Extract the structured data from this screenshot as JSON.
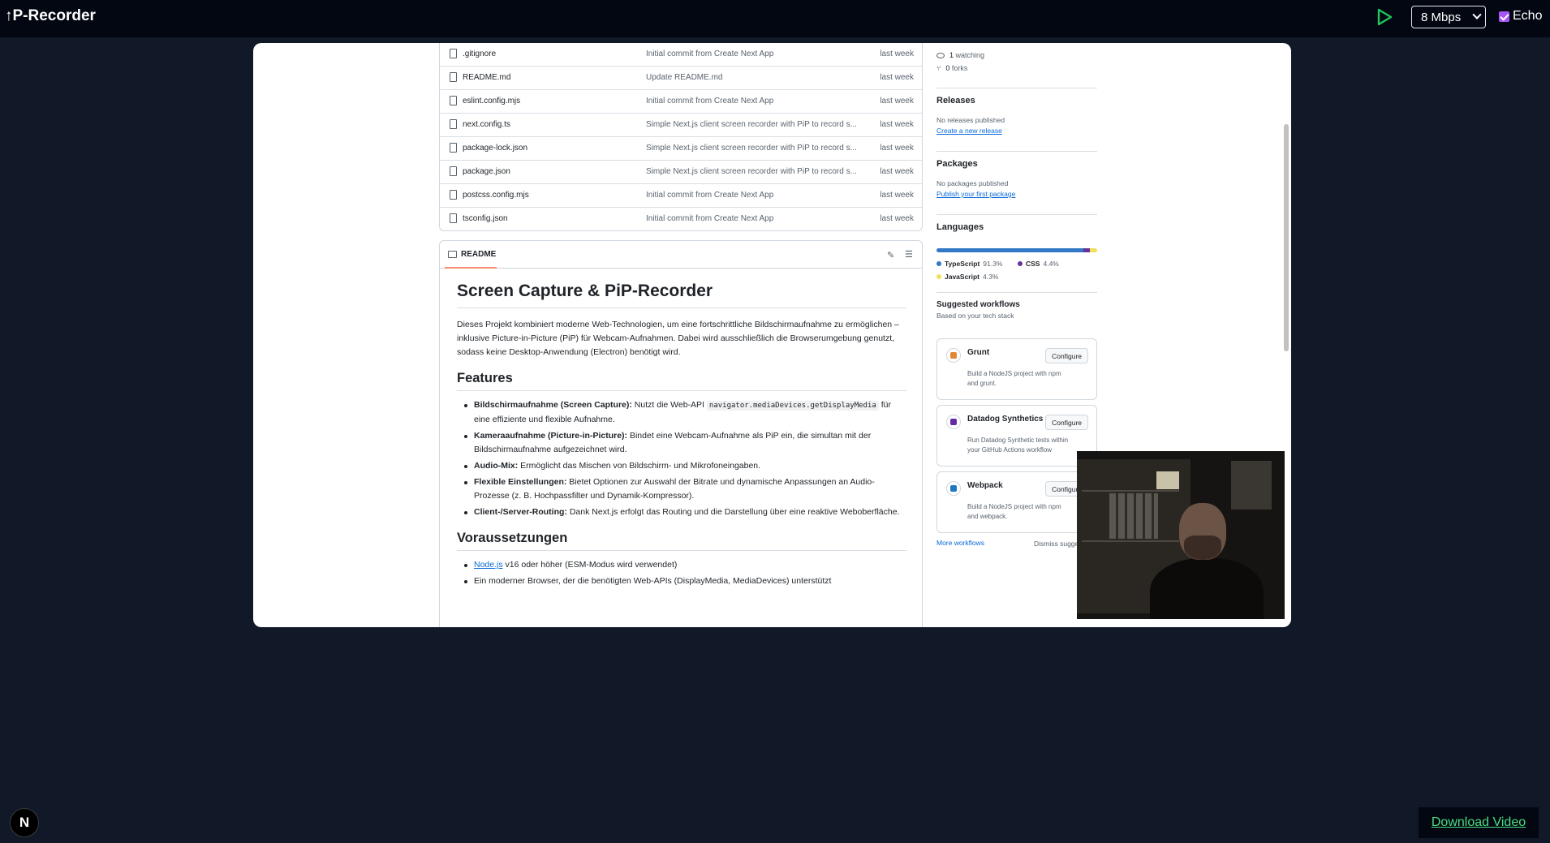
{
  "app": {
    "title": "↑P-Recorder"
  },
  "toolbar": {
    "bitrate_selected": "8 Mbps",
    "echo_label": "Echo",
    "echo_checked": true,
    "accent_color": "#22c55e",
    "checkbox_color": "#a855f7"
  },
  "files": [
    {
      "name": ".gitignore",
      "message": "Initial commit from Create Next App",
      "date": "last week"
    },
    {
      "name": "README.md",
      "message": "Update README.md",
      "date": "last week"
    },
    {
      "name": "eslint.config.mjs",
      "message": "Initial commit from Create Next App",
      "date": "last week"
    },
    {
      "name": "next.config.ts",
      "message": "Simple Next.js client screen recorder with PiP to record s...",
      "date": "last week"
    },
    {
      "name": "package-lock.json",
      "message": "Simple Next.js client screen recorder with PiP to record s...",
      "date": "last week"
    },
    {
      "name": "package.json",
      "message": "Simple Next.js client screen recorder with PiP to record s...",
      "date": "last week"
    },
    {
      "name": "postcss.config.mjs",
      "message": "Initial commit from Create Next App",
      "date": "last week"
    },
    {
      "name": "tsconfig.json",
      "message": "Initial commit from Create Next App",
      "date": "last week"
    }
  ],
  "readme": {
    "tab_label": "README",
    "title": "Screen Capture & PiP-Recorder",
    "intro": "Dieses Projekt kombiniert moderne Web-Technologien, um eine fortschrittliche Bildschirmaufnahme zu ermöglichen – inklusive Picture-in-Picture (PiP) für Webcam-Aufnahmen. Dabei wird ausschließlich die Browserumgebung genutzt, sodass keine Desktop-Anwendung (Electron) benötigt wird.",
    "features_heading": "Features",
    "features": {
      "f1_bold": "Bildschirmaufnahme (Screen Capture):",
      "f1_pre": " Nutzt die Web-API ",
      "f1_code": "navigator.mediaDevices.getDisplayMedia",
      "f1_post": " für eine effiziente und flexible Aufnahme.",
      "f2_bold": "Kameraaufnahme (Picture-in-Picture):",
      "f2_text": " Bindet eine Webcam-Aufnahme als PiP ein, die simultan mit der Bildschirmaufnahme aufgezeichnet wird.",
      "f3_bold": "Audio-Mix:",
      "f3_text": " Ermöglicht das Mischen von Bildschirm- und Mikrofoneingaben.",
      "f4_bold": "Flexible Einstellungen:",
      "f4_text": " Bietet Optionen zur Auswahl der Bitrate und dynamische Anpassungen an Audio-Prozesse (z. B. Hochpassfilter und Dynamik-Kompressor).",
      "f5_bold": "Client-/Server-Routing:",
      "f5_text": " Dank Next.js erfolgt das Routing und die Darstellung über eine reaktive Weboberfläche."
    },
    "prereq_heading": "Voraussetzungen",
    "prereq": {
      "p1_link": "Node.js",
      "p1_text": " v16 oder höher (ESM-Modus wird verwendet)",
      "p2_text": "Ein moderner Browser, der die benötigten Web-APIs (DisplayMedia, MediaDevices) unterstützt"
    }
  },
  "sidebar": {
    "watching_count": "1",
    "watching_label": " watching",
    "forks_count": "0",
    "forks_label": " forks",
    "releases_heading": "Releases",
    "releases_text": "No releases published",
    "releases_link": "Create a new release",
    "packages_heading": "Packages",
    "packages_text": "No packages published",
    "packages_link": "Publish your first package",
    "languages_heading": "Languages",
    "languages": [
      {
        "name": "TypeScript",
        "pct": "91.3%",
        "value": 91.3,
        "color": "#3178c6"
      },
      {
        "name": "CSS",
        "pct": "4.4%",
        "value": 4.4,
        "color": "#663399"
      },
      {
        "name": "JavaScript",
        "pct": "4.3%",
        "value": 4.3,
        "color": "#f1e05a"
      }
    ],
    "workflows_heading": "Suggested workflows",
    "workflows_sub": "Based on your tech stack",
    "workflows": [
      {
        "name": "Grunt",
        "desc": "Build a NodeJS project with npm and grunt.",
        "button": "Configure",
        "color": "#e48632"
      },
      {
        "name": "Datadog Synthetics",
        "desc": "Run Datadog Synthetic tests within your GitHub Actions workflow",
        "button": "Configure",
        "color": "#632ca6"
      },
      {
        "name": "Webpack",
        "desc": "Build a NodeJS project with npm and webpack.",
        "button": "Configure",
        "color": "#1c78c0"
      }
    ],
    "more_workflows": "More workflows",
    "dismiss": "Dismiss sugge"
  },
  "footer": {
    "next_badge": "N",
    "download_label": "Download Video"
  }
}
